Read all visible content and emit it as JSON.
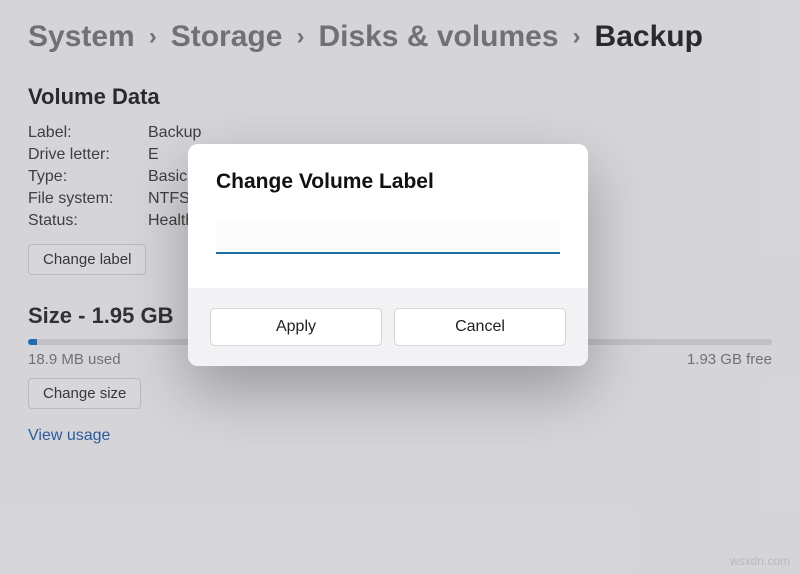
{
  "breadcrumb": {
    "items": [
      "System",
      "Storage",
      "Disks & volumes",
      "Backup"
    ]
  },
  "section": {
    "title": "Volume Data"
  },
  "volume": {
    "rows": [
      {
        "key": "Label:",
        "val": "Backup"
      },
      {
        "key": "Drive letter:",
        "val": "E"
      },
      {
        "key": "Type:",
        "val": "Basic"
      },
      {
        "key": "File system:",
        "val": "NTFS"
      },
      {
        "key": "Status:",
        "val": "Healthy"
      }
    ],
    "change_label_btn": "Change label"
  },
  "size": {
    "heading": "Size - 1.95 GB",
    "used": "18.9 MB used",
    "free": "1.93 GB free",
    "change_size_btn": "Change size",
    "view_usage": "View usage"
  },
  "dialog": {
    "title": "Change Volume Label",
    "input_value": "",
    "apply": "Apply",
    "cancel": "Cancel"
  },
  "watermark": "wsxdn.com"
}
